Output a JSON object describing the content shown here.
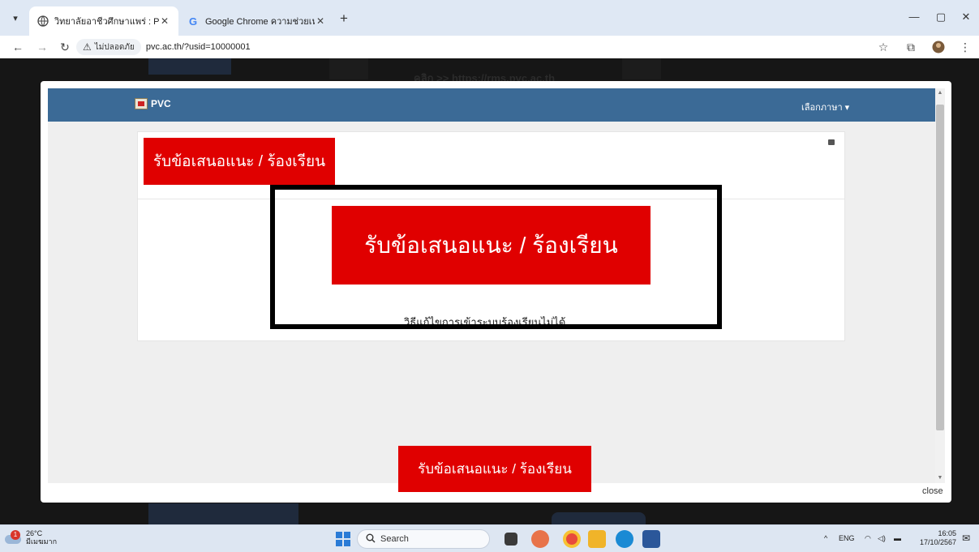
{
  "browser": {
    "tabs": [
      {
        "label": "วิทยาลัยอาชีวศึกษาแพร่ : PVC : วิทย",
        "active": true
      },
      {
        "label": "Google Chrome ความช่วยเหลือ",
        "active": false
      }
    ],
    "new_tab": "+",
    "address": {
      "security_label": "ไม่ปลอดภัย",
      "url": "pvc.ac.th/?usid=10000001"
    }
  },
  "page": {
    "navbar": {
      "brand": "PVC",
      "language_menu": "เลือกภาษา ▾"
    },
    "complaint_button_top": "รับข้อเสนอแนะ / ร้องเรียน",
    "complaint_button_main": "รับข้อเสนอแนะ / ร้องเรียน",
    "help_link": "วิธีแก้ไขการเข้าระบบร้องเรียนไม่ได้",
    "complaint_button_bottom": "รับข้อเสนอแนะ / ร้องเรียน",
    "close_label": "close",
    "background_text": "คลิก >> https://rms.pvc.ac.th"
  },
  "taskbar": {
    "weather_temp": "26°C",
    "weather_desc": "มีเมฆมาก",
    "weather_badge": "1",
    "search_placeholder": "Search",
    "lang": "ENG",
    "time": "16:05",
    "date": "17/10/2567"
  },
  "colors": {
    "accent_red": "#e00000",
    "navbar_blue": "#3b6a96"
  }
}
